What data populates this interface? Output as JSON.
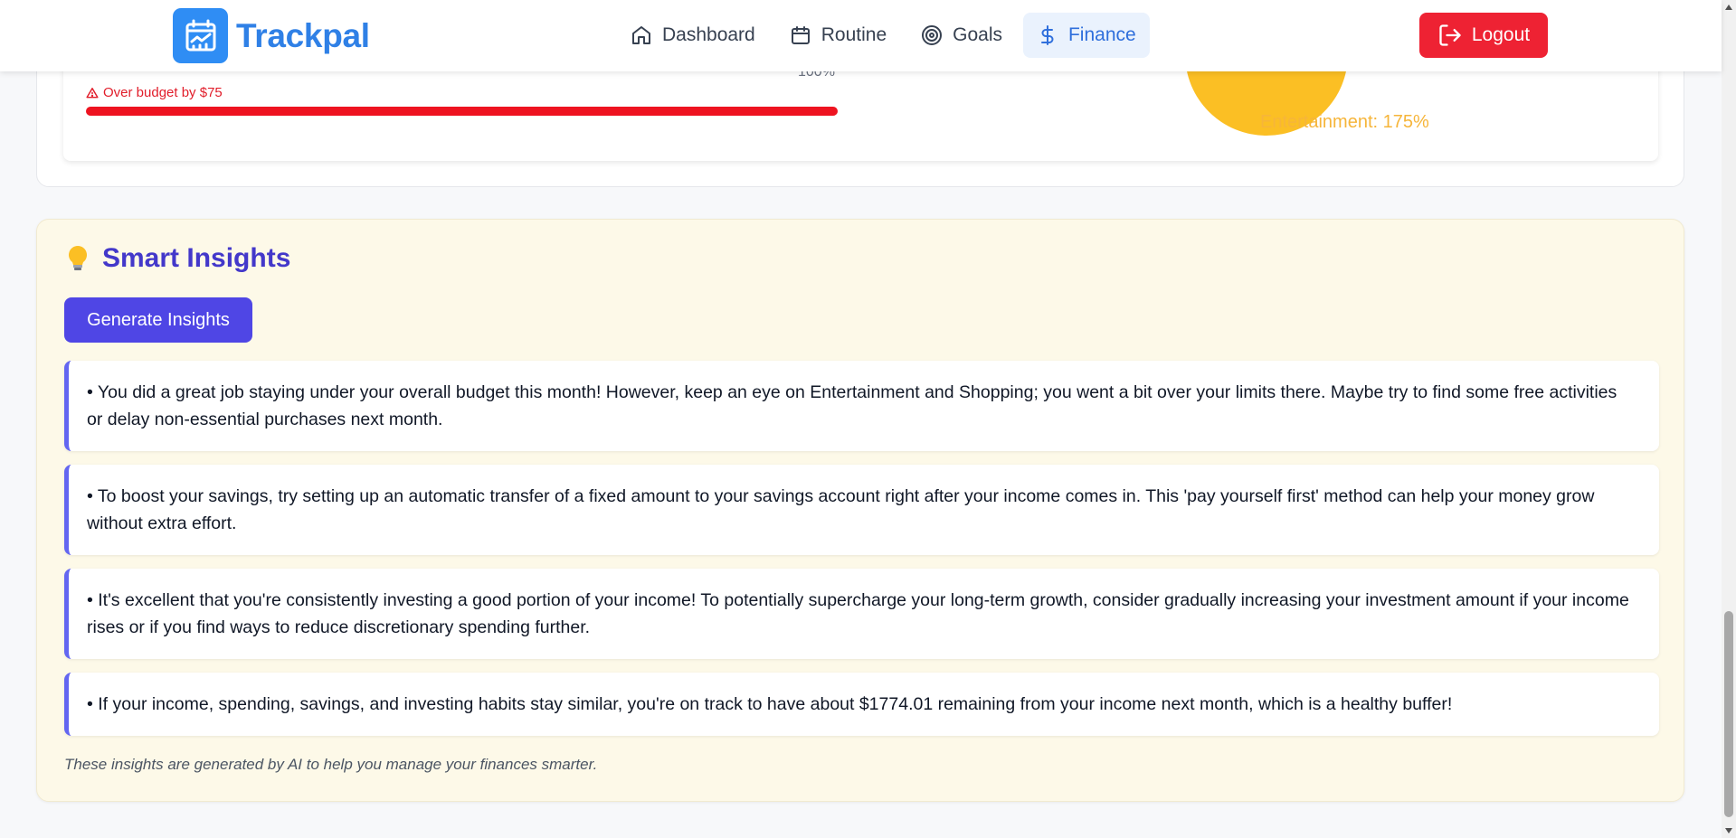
{
  "app": {
    "name": "Trackpal"
  },
  "nav": {
    "items": [
      {
        "label": "Dashboard",
        "icon": "home-icon"
      },
      {
        "label": "Routine",
        "icon": "calendar-icon"
      },
      {
        "label": "Goals",
        "icon": "target-icon"
      },
      {
        "label": "Finance",
        "icon": "dollar-icon",
        "active": true
      }
    ],
    "logout_label": "Logout"
  },
  "budget": {
    "percent_label": "100%",
    "over_budget_text": "Over budget by $75",
    "progress_fraction": 1.0,
    "pie_label": "Entertainment: 175%"
  },
  "insights": {
    "title": "Smart Insights",
    "icon": "lightbulb-icon",
    "button_label": "Generate Insights",
    "items": [
      "• You did a great job staying under your overall budget this month! However, keep an eye on Entertainment and Shopping; you went a bit over your limits there. Maybe try to find some free activities or delay non-essential purchases next month.",
      "• To boost your savings, try setting up an automatic transfer of a fixed amount to your savings account right after your income comes in. This 'pay yourself first' method can help your money grow without extra effort.",
      "• It's excellent that you're consistently investing a good portion of your income! To potentially supercharge your long-term growth, consider gradually increasing your investment amount if your income rises or if you find ways to reduce discretionary spending further.",
      "• If your income, spending, savings, and investing habits stay similar, you're on track to have about $1774.01 remaining from your income next month, which is a healthy buffer!"
    ],
    "footer": "These insights are generated by AI to help you manage your finances smarter."
  },
  "colors": {
    "brand": "#2f80e6",
    "accent": "#4f46e5",
    "danger": "#ee2233",
    "pie_entertainment": "#fbbf24"
  }
}
